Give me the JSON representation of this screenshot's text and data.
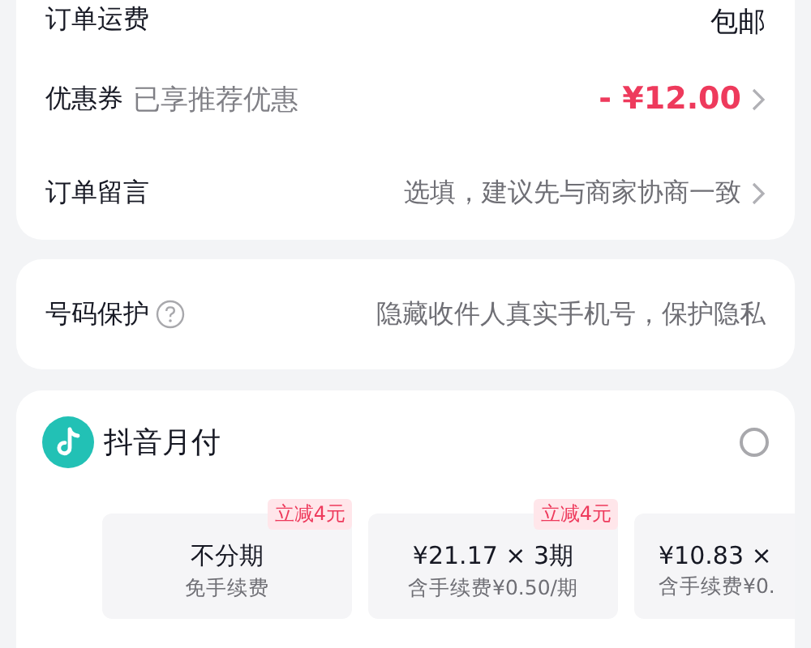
{
  "order_card": {
    "rows": [
      {
        "kind": "plain",
        "label": "订单运费",
        "value": "包邮"
      },
      {
        "kind": "discount",
        "label": "优惠券",
        "hint": "已享推荐优惠",
        "value": "- ¥12.00"
      },
      {
        "kind": "link",
        "label": "订单留言",
        "value": "选填，建议先与商家协商一致"
      }
    ]
  },
  "privacy_card": {
    "label": "号码保护",
    "value": "隐藏收件人真实手机号，保护隐私"
  },
  "payment": {
    "name": "抖音月付",
    "selected": false,
    "plans": [
      {
        "title": "不分期",
        "subtitle": "免手续费",
        "badge": "立减4元",
        "selected": false
      },
      {
        "title": "¥21.17 × 3期",
        "subtitle": "含手续费¥0.50/期",
        "badge": "立减4元",
        "selected": false
      },
      {
        "title": "¥10.83 ×",
        "subtitle": "含手续费¥0.",
        "selected": false
      }
    ]
  }
}
